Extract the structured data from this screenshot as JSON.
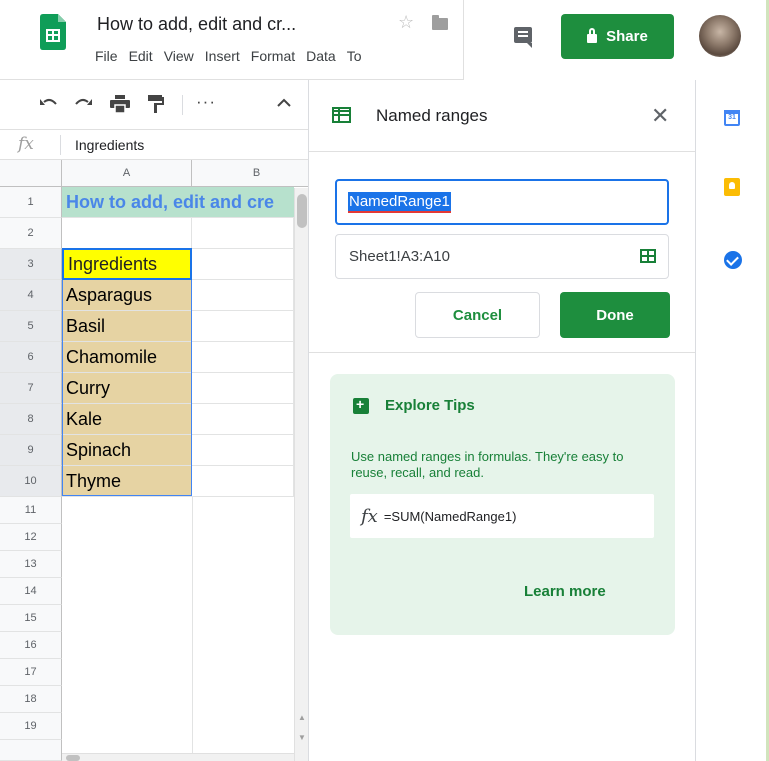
{
  "header": {
    "doc_title": "How to add, edit and cr...",
    "menu": [
      "File",
      "Edit",
      "View",
      "Insert",
      "Format",
      "Data",
      "To"
    ],
    "share_label": "Share"
  },
  "toolbar": {
    "undo_icon": "undo-icon",
    "redo_icon": "redo-icon",
    "print_icon": "print-icon",
    "paint_format_icon": "paint-format-icon",
    "more_icon": "more-icon",
    "collapse_icon": "chevron-up-icon"
  },
  "formula_bar": {
    "fx": "fx",
    "value": "Ingredients"
  },
  "grid": {
    "columns": [
      "A",
      "B"
    ],
    "rows": [
      "1",
      "2",
      "3",
      "4",
      "5",
      "6",
      "7",
      "8",
      "9",
      "10",
      "11",
      "12",
      "13",
      "14",
      "15",
      "16",
      "17",
      "18",
      "19"
    ],
    "title_cell": "How to add, edit and cre",
    "active_cell": "Ingredients",
    "range_cells": [
      "Asparagus",
      "Basil",
      "Chamomile",
      "Curry",
      "Kale",
      "Spinach",
      "Thyme"
    ]
  },
  "panel": {
    "title": "Named ranges",
    "name_value": "NamedRange1",
    "range_value": "Sheet1!A3:A10",
    "cancel_label": "Cancel",
    "done_label": "Done",
    "tips": {
      "title": "Explore Tips",
      "text": "Use named ranges in formulas. They're easy to reuse, recall, and read.",
      "formula_fx": "fx",
      "formula": "=SUM(NamedRange1)",
      "learn_more": "Learn more"
    }
  },
  "side_panel": {
    "calendar_day": "31"
  },
  "colors": {
    "accent_green": "#1e8e3e",
    "selection_blue": "#1a73e8",
    "title_text": "#4a86e8",
    "title_fill": "#b7e1cd",
    "range_fill": "#e6d3a3",
    "active_fill": "#ffff00"
  }
}
